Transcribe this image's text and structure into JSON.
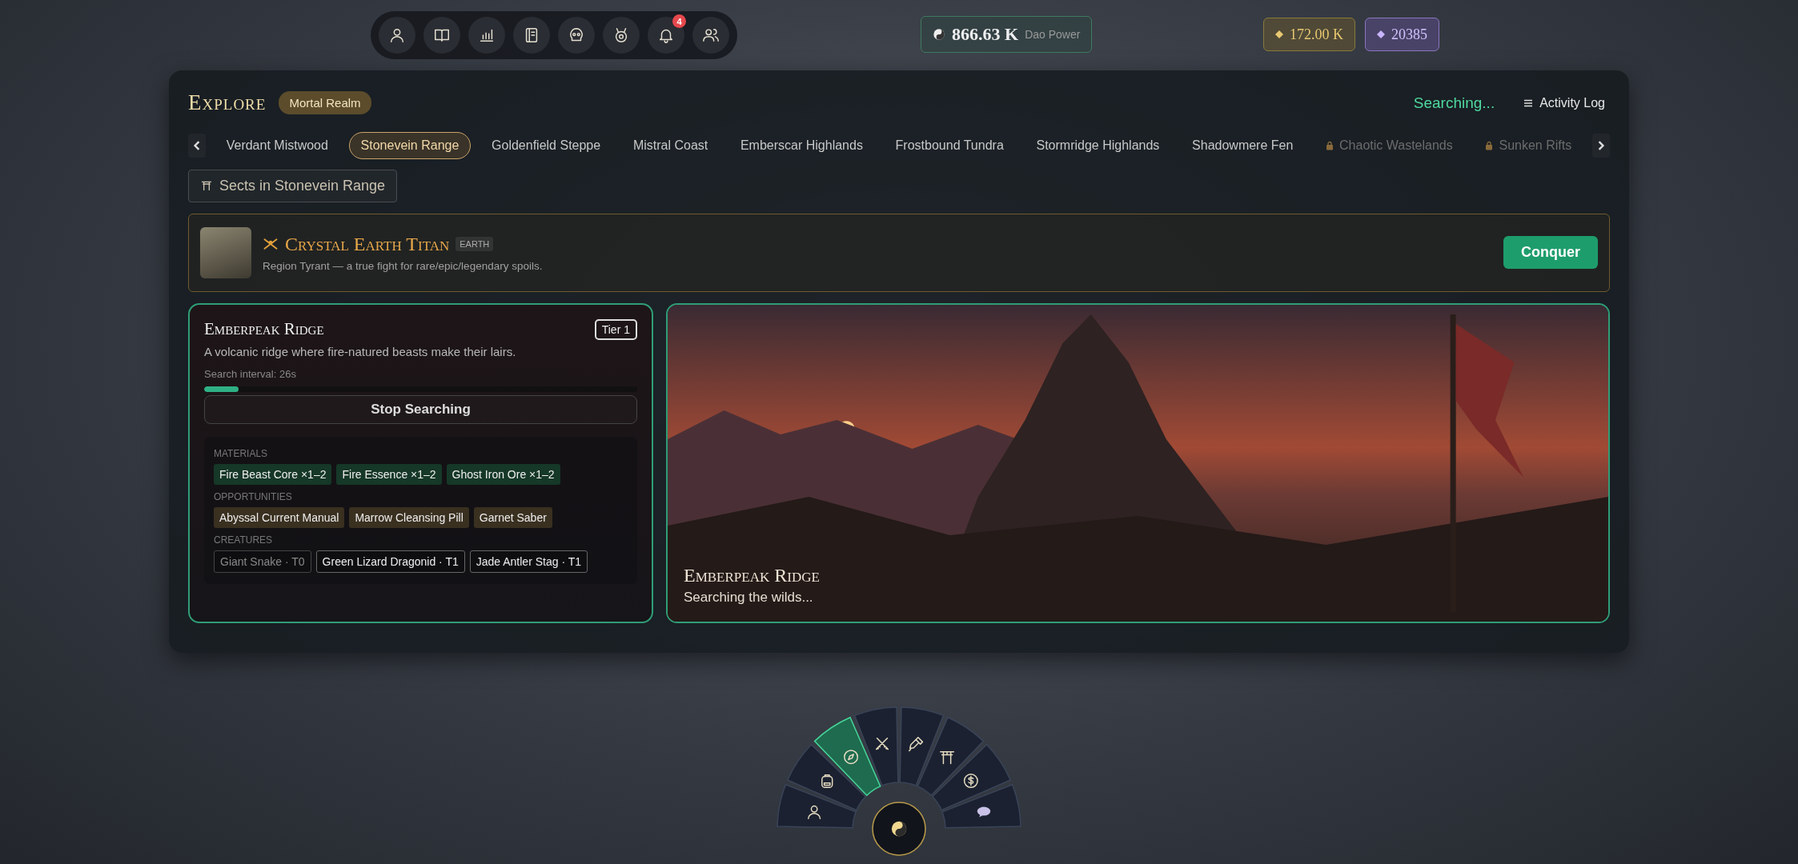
{
  "top_nav": {
    "notification_count": "4"
  },
  "dao_power": {
    "value": "866.63 K",
    "label": "Dao Power"
  },
  "currencies": [
    {
      "kind": "gold",
      "value": "172.00 K"
    },
    {
      "kind": "spirit",
      "value": "20385"
    }
  ],
  "explore": {
    "title": "Explore",
    "realm": "Mortal Realm",
    "status": "Searching...",
    "activity_log": "Activity Log",
    "regions": [
      {
        "label": "Verdant Mistwood",
        "selected": false,
        "locked": false
      },
      {
        "label": "Stonevein Range",
        "selected": true,
        "locked": false
      },
      {
        "label": "Goldenfield Steppe",
        "selected": false,
        "locked": false
      },
      {
        "label": "Mistral Coast",
        "selected": false,
        "locked": false
      },
      {
        "label": "Emberscar Highlands",
        "selected": false,
        "locked": false
      },
      {
        "label": "Frostbound Tundra",
        "selected": false,
        "locked": false
      },
      {
        "label": "Stormridge Highlands",
        "selected": false,
        "locked": false
      },
      {
        "label": "Shadowmere Fen",
        "selected": false,
        "locked": false
      },
      {
        "label": "Chaotic Wastelands",
        "selected": false,
        "locked": true
      },
      {
        "label": "Sunken Rifts",
        "selected": false,
        "locked": true
      }
    ],
    "sects_button": "Sects in Stonevein Range",
    "boss": {
      "name": "Crystal Earth Titan",
      "element": "EARTH",
      "description": "Region Tyrant — a true fight for rare/epic/legendary spoils.",
      "action": "Conquer"
    },
    "area": {
      "name": "Emberpeak Ridge",
      "tier": "Tier 1",
      "description": "A volcanic ridge where fire-natured beasts make their lairs.",
      "interval": "Search interval: 26s",
      "level": 0.08,
      "action": "Stop Searching",
      "sections": [
        {
          "kind": "material",
          "title": "MATERIALS",
          "items": [
            {
              "label": "Fire Beast Core ×1–2",
              "dimmed": false
            },
            {
              "label": "Fire Essence ×1–2",
              "dimmed": false
            },
            {
              "label": "Ghost Iron Ore ×1–2",
              "dimmed": false
            }
          ]
        },
        {
          "kind": "opportunity",
          "title": "OPPORTUNITIES",
          "items": [
            {
              "label": "Abyssal Current Manual",
              "dimmed": false
            },
            {
              "label": "Marrow Cleansing Pill",
              "dimmed": false
            },
            {
              "label": "Garnet Saber",
              "dimmed": false
            }
          ]
        },
        {
          "kind": "creature",
          "title": "CREATURES",
          "items": [
            {
              "label": "Giant Snake · T0",
              "dimmed": true
            },
            {
              "label": "Green Lizard Dragonid · T1",
              "dimmed": false
            },
            {
              "label": "Jade Antler Stag · T1",
              "dimmed": false
            }
          ]
        }
      ]
    },
    "scene": {
      "title": "Emberpeak Ridge",
      "subtitle": "Searching the wilds..."
    }
  },
  "radial_menu": {
    "items": [
      {
        "selected": false
      },
      {
        "selected": false
      },
      {
        "selected": true
      },
      {
        "selected": false
      },
      {
        "selected": false
      },
      {
        "selected": false
      },
      {
        "selected": false
      },
      {
        "selected": false
      }
    ]
  }
}
